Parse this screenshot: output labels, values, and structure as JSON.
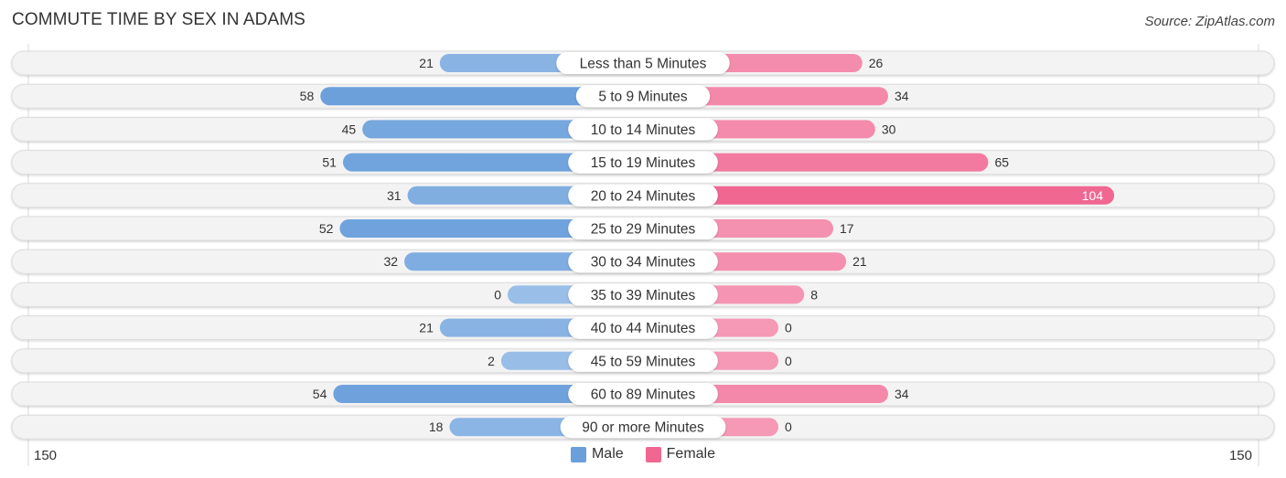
{
  "title": "COMMUTE TIME BY SEX IN ADAMS",
  "source": "Source: ZipAtlas.com",
  "colors": {
    "male": "#6a9fdb",
    "female": "#f06792",
    "male_light": "#a9c8ec",
    "female_light": "#f7a9c2"
  },
  "legend": [
    {
      "name": "Male",
      "color": "#6a9fdb"
    },
    {
      "name": "Female",
      "color": "#f06792"
    }
  ],
  "axis": {
    "left_label": "150",
    "right_label": "150"
  },
  "chart_data": {
    "type": "bar",
    "orientation": "horizontal-diverging",
    "title": "COMMUTE TIME BY SEX IN ADAMS",
    "categories": [
      "Less than 5 Minutes",
      "5 to 9 Minutes",
      "10 to 14 Minutes",
      "15 to 19 Minutes",
      "20 to 24 Minutes",
      "25 to 29 Minutes",
      "30 to 34 Minutes",
      "35 to 39 Minutes",
      "40 to 44 Minutes",
      "45 to 59 Minutes",
      "60 to 89 Minutes",
      "90 or more Minutes"
    ],
    "series": [
      {
        "name": "Male",
        "values": [
          21,
          58,
          45,
          51,
          31,
          52,
          32,
          0,
          21,
          2,
          54,
          18
        ]
      },
      {
        "name": "Female",
        "values": [
          26,
          34,
          30,
          65,
          104,
          17,
          21,
          8,
          0,
          0,
          34,
          0
        ]
      }
    ],
    "xlim": [
      -150,
      150
    ],
    "tick_labels": [
      "150",
      "150"
    ],
    "legend_position": "bottom-center",
    "grid": false
  }
}
